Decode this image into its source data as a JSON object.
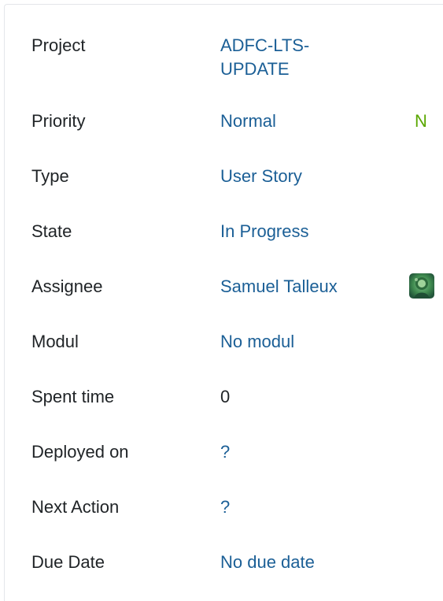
{
  "fields": [
    {
      "label": "Project",
      "value": "ADFC-LTS-UPDATE"
    },
    {
      "label": "Priority",
      "value": "Normal",
      "badge": "N",
      "badge_color": "#5aa700"
    },
    {
      "label": "Type",
      "value": "User Story"
    },
    {
      "label": "State",
      "value": "In Progress"
    },
    {
      "label": "Assignee",
      "value": "Samuel Talleux",
      "avatar_icon": "user-avatar"
    },
    {
      "label": "Modul",
      "value": "No modul"
    },
    {
      "label": "Spent time",
      "value": "0"
    },
    {
      "label": "Deployed on",
      "value": "?"
    },
    {
      "label": "Next Action",
      "value": "?"
    },
    {
      "label": "Due Date",
      "value": "No due date"
    }
  ],
  "colors": {
    "link": "#1b5f96",
    "text": "#1f2326",
    "priority_badge": "#5aa700"
  }
}
